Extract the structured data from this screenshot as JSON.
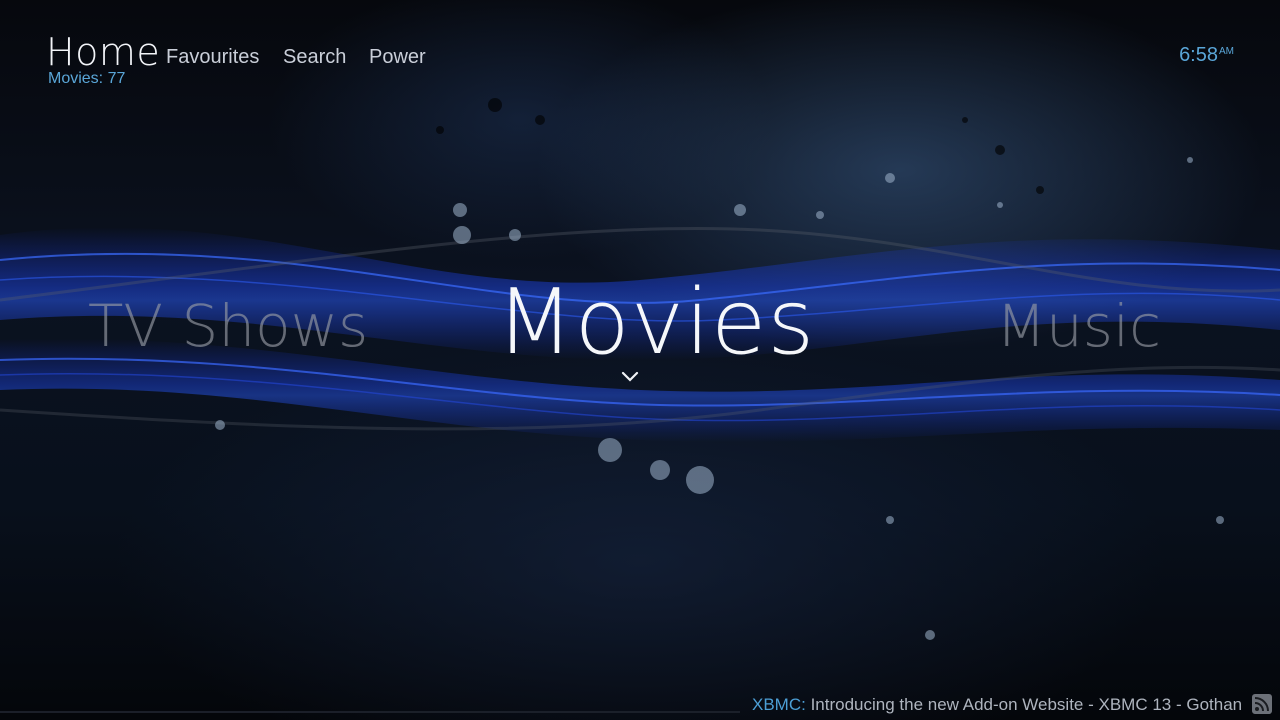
{
  "header": {
    "title": "Home",
    "subtitle": "Movies: 77",
    "nav": [
      {
        "label": "Favourites"
      },
      {
        "label": "Search"
      },
      {
        "label": "Power"
      }
    ],
    "clock": {
      "time": "6:58",
      "ampm": "AM"
    }
  },
  "main_menu": {
    "items": [
      {
        "label": "TV Shows",
        "selected": false
      },
      {
        "label": "Movies",
        "selected": true
      },
      {
        "label": "Music",
        "selected": false
      }
    ]
  },
  "ticker": {
    "source": "XBMC:",
    "text": "Introducing the new Add-on Website - XBMC 13 - Gothan"
  },
  "colors": {
    "accent": "#5aa6d8",
    "wave_blue": "#1e46e6",
    "background": "#05070c"
  },
  "icons": {
    "selection_indicator": "chevron-down-icon",
    "rss": "rss-icon"
  }
}
